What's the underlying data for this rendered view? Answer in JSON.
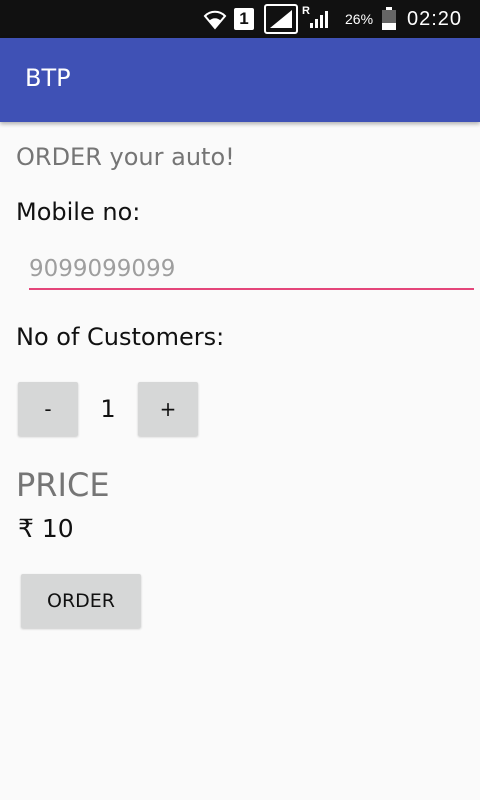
{
  "status_bar": {
    "sim_slot": "1",
    "roaming": "R",
    "battery_percent": "26%",
    "time": "02:20",
    "icons": [
      "wifi-icon",
      "sim-icon",
      "signal-icon",
      "roaming-signal-icon",
      "battery-icon"
    ]
  },
  "app_bar": {
    "title": "BTP",
    "color": "#3f51b5"
  },
  "form": {
    "subtitle": "ORDER your auto!",
    "mobile_label": "Mobile no:",
    "mobile_value": "",
    "mobile_placeholder": "9099099099",
    "accent_color": "#e4457a",
    "customers_label": "No of Customers:",
    "minus_label": "-",
    "quantity": "1",
    "plus_label": "+",
    "price_heading": "PRICE",
    "price_value": "₹ 10",
    "order_label": "ORDER"
  }
}
